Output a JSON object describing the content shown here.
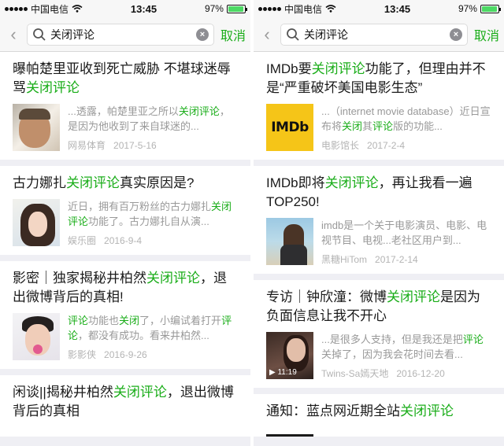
{
  "status": {
    "carrier": "中国电信",
    "wifi_icon": "wifi-icon",
    "left_time": "13:45",
    "right_time": "13:45",
    "battery_text": "97%",
    "battery_level": 0.97
  },
  "search": {
    "query": "关闭评论",
    "cancel_label": "取消"
  },
  "left_results": [
    {
      "title_pre": "曝帕楚里亚收到死亡威胁 不堪球迷辱骂",
      "title_hl": "关闭评论",
      "title_post": "",
      "snippet_pre": "...透露，帕楚里亚之所以",
      "snippet_hl": "关闭评论",
      "snippet_post": "，是因为他收到了来自球迷的...",
      "source": "网易体育",
      "date": "2017-5-16"
    },
    {
      "title_pre": "古力娜扎",
      "title_hl": "关闭评论",
      "title_post": "真实原因是?",
      "snippet_pre": "近日，拥有百万粉丝的古力娜扎",
      "snippet_hl": "关闭评论",
      "snippet_post": "功能了。古力娜扎自从演...",
      "source": "娱乐圈",
      "date": "2016-9-4"
    },
    {
      "title_pre": "影密｜独家揭秘井柏然",
      "title_hl": "关闭评论",
      "title_post": "，退出微博背后的真相!",
      "snippet_pre": "",
      "snippet_hl": "评论",
      "snippet_mid": "功能也",
      "snippet_hl2": "关闭",
      "snippet_mid2": "了，小编试着打开",
      "snippet_hl3": "评论",
      "snippet_post": "，都没有成功。看来井柏然...",
      "source": "影影侠",
      "date": "2016-9-26"
    },
    {
      "title_pre": "闲谈||揭秘井柏然",
      "title_hl": "关闭评论",
      "title_post": "，退出微博背后的真相"
    }
  ],
  "right_results": [
    {
      "title_pre": "IMDb要",
      "title_hl": "关闭评论",
      "title_post": "功能了，但理由并不是“严重破坏美国电影生态”",
      "snippet_pre": "...（internet movie database）近日宣布将",
      "snippet_hl": "关闭",
      "snippet_mid": "其",
      "snippet_hl2": "评论",
      "snippet_post": "版的功能...",
      "thumb_text": "IMDb",
      "source": "电影馆长",
      "date": "2017-2-4"
    },
    {
      "title_pre": "IMDb即将",
      "title_hl": "关闭评论",
      "title_post": "，再让我看一遍TOP250!",
      "snippet_pre": "imdb是一个关于电影演员、电影、电视节目、电视...老社区用户到...",
      "source": "黑糖HiTom",
      "date": "2017-2-14"
    },
    {
      "title_pre": "专访｜钟欣潼：微博",
      "title_hl": "关闭评论",
      "title_post": "是因为负面信息让我不开心",
      "snippet_pre": "...是很多人支持，但是我还是把",
      "snippet_hl": "评论",
      "snippet_post": "关掉了，因为我会花时间去看...",
      "video_time": "11:19",
      "source": "Twins-Sa嫣天地",
      "date": "2016-12-20"
    },
    {
      "title_pre": "通知：蓝点网近期全站",
      "title_hl": "关闭评论",
      "title_post": ""
    }
  ]
}
